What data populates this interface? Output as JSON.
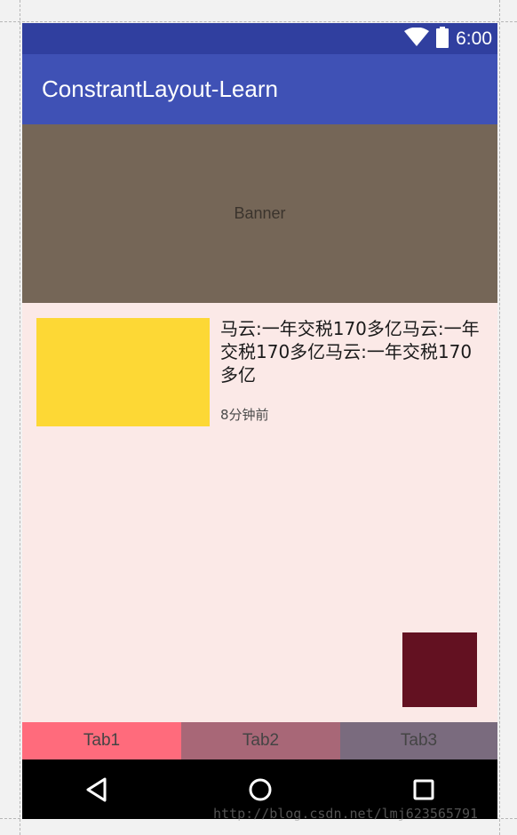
{
  "status_bar": {
    "time": "6:00",
    "icons": [
      "wifi-icon",
      "battery-icon"
    ]
  },
  "app_bar": {
    "title": "ConstrantLayout-Learn"
  },
  "banner": {
    "label": "Banner"
  },
  "news_item": {
    "title": "马云:一年交税170多亿马云:一年交税170多亿马云:一年交税170多亿",
    "time": "8分钟前"
  },
  "tabs": [
    {
      "label": "Tab1"
    },
    {
      "label": "Tab2"
    },
    {
      "label": "Tab3"
    }
  ],
  "nav_bar": {
    "icons": [
      "back-icon",
      "home-icon",
      "recent-apps-icon"
    ]
  },
  "watermark": "http://blog.csdn.net/lmj623565791",
  "colors": {
    "status_bar": "#303f9f",
    "app_bar": "#3f51b5",
    "banner": "#756657",
    "content_background": "#fbe9e7",
    "thumbnail": "#fdd835",
    "corner_square": "#631121",
    "tab1": "#ff6b7c",
    "tab2": "#a86777",
    "tab3": "#7a6b7e",
    "nav_bar": "#000000"
  }
}
